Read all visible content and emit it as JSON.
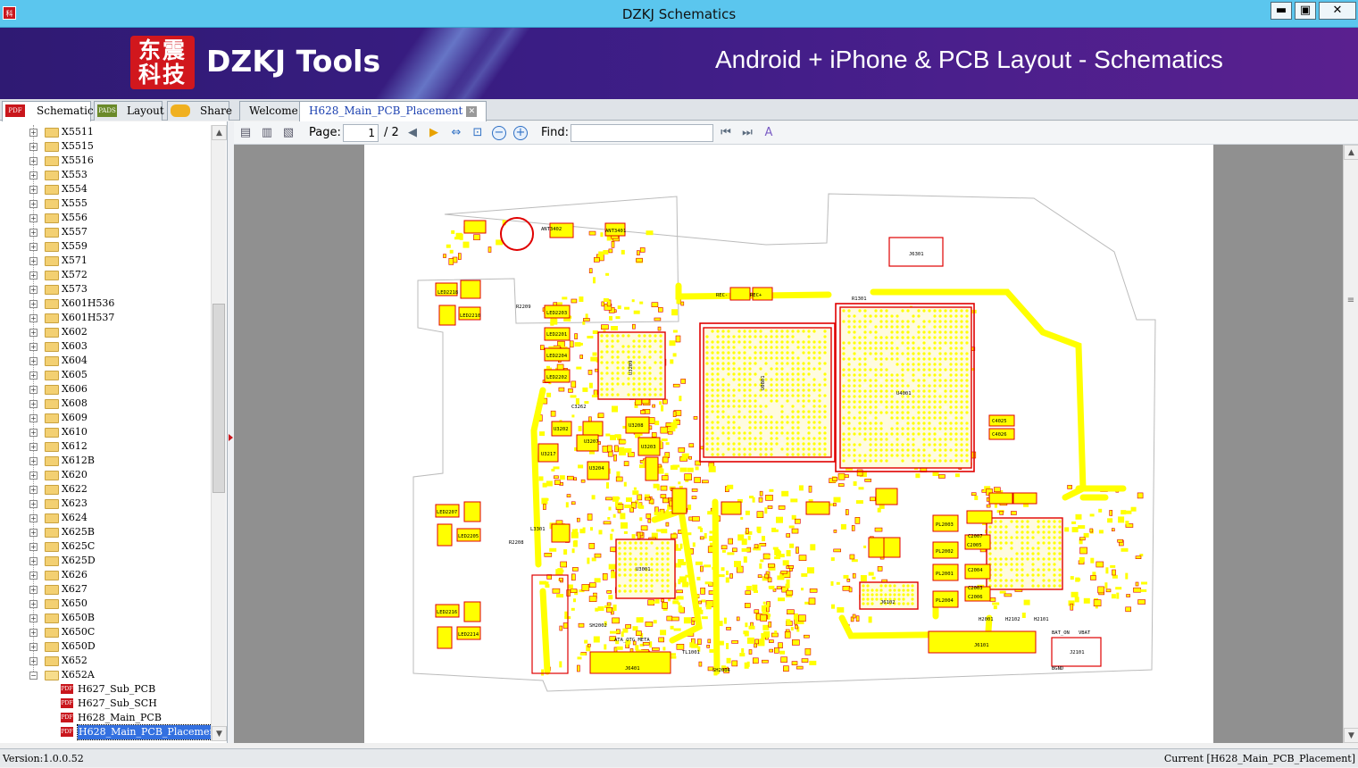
{
  "window": {
    "title": "DZKJ Schematics",
    "buttons": {
      "minimize": "▬",
      "maximize": "▣",
      "close": "✕"
    }
  },
  "banner": {
    "logo_text": "东震科技",
    "brand": "DZKJ Tools",
    "tagline": "Android + iPhone & PCB Layout - Schematics"
  },
  "left_tabs": [
    {
      "icon": "PDF",
      "label": "Schematic"
    },
    {
      "icon": "PADS",
      "label": "Layout"
    },
    {
      "icon": "cloud",
      "label": "Share"
    }
  ],
  "doc_tabs": [
    {
      "label": "Welcome"
    },
    {
      "label": "H628_Main_PCB_Placement",
      "close": "✕"
    }
  ],
  "tree": {
    "folders": [
      "X5511",
      "X5515",
      "X5516",
      "X553",
      "X554",
      "X555",
      "X556",
      "X557",
      "X559",
      "X571",
      "X572",
      "X573",
      "X601H536",
      "X601H537",
      "X602",
      "X603",
      "X604",
      "X605",
      "X606",
      "X608",
      "X609",
      "X610",
      "X612",
      "X612B",
      "X620",
      "X622",
      "X623",
      "X624",
      "X625B",
      "X625C",
      "X625D",
      "X626",
      "X627",
      "X650",
      "X650B",
      "X650C",
      "X650D",
      "X652"
    ],
    "expanded_folder": "X652A",
    "files": [
      "H627_Sub_PCB",
      "H627_Sub_SCH",
      "H628_Main_PCB",
      "H628_Main_PCB_Placement"
    ],
    "selected_file": "H628_Main_PCB_Placement"
  },
  "toolbar": {
    "page_label": "Page:",
    "page_value": "1",
    "page_total": "/ 2",
    "find_label": "Find:",
    "find_value": ""
  },
  "colors": {
    "titlebar": "#5bc6ee",
    "banner": "#3a1d84",
    "pcb_pad": "#ffff00",
    "pcb_outline": "#e00000",
    "selection": "#3370e0"
  },
  "pcb_labels": {
    "u4001": "U4001",
    "u0801": "U0801",
    "u3001": "U3001",
    "u3209": "U3209",
    "j6301": "J6301",
    "j6401": "J6401",
    "j6102": "J6102",
    "j6101": "J6101",
    "j2101": "J2101",
    "sh2002": "SH2002",
    "sh2004": "SH2004",
    "bat_on": "BAT_ON",
    "ata_otg_meta": "ATA_OTG META",
    "vbat": "VBAT",
    "bgnd": "BGND",
    "led2201": "LED2201",
    "led2204": "LED2204",
    "led2202": "LED2202",
    "led2203": "LED2203",
    "led2207": "LED2207",
    "led2205": "LED2205",
    "led2216": "LED2216",
    "led2214": "LED2214",
    "led2218": "LED2218",
    "led2210": "LED2210",
    "ant3402": "ANT3402",
    "ant3401": "ANT3401",
    "pl2003": "PL2003",
    "pl2002": "PL2002",
    "pl2001": "PL2001",
    "pl2004": "PL2004",
    "c4025": "C4025",
    "c4026": "C4026",
    "c2005": "C2005",
    "c2007": "C2007",
    "c2004": "C2004",
    "c2003": "C2003",
    "c2006": "C2006",
    "h2001": "H2001",
    "h2102": "H2102",
    "h2101": "H2101",
    "r2209": "R2209",
    "r2208": "R2208",
    "u3202": "U3202",
    "u3207": "U3207",
    "u3203": "U3203",
    "u3204": "U3204",
    "u3208": "U3208",
    "u3217": "U3217",
    "c3262": "C3262",
    "l3301": "L3301",
    "tl1001": "TL1001",
    "rec_neg": "REC-",
    "rec_pos": "REC+",
    "r1301": "R1301"
  }
}
